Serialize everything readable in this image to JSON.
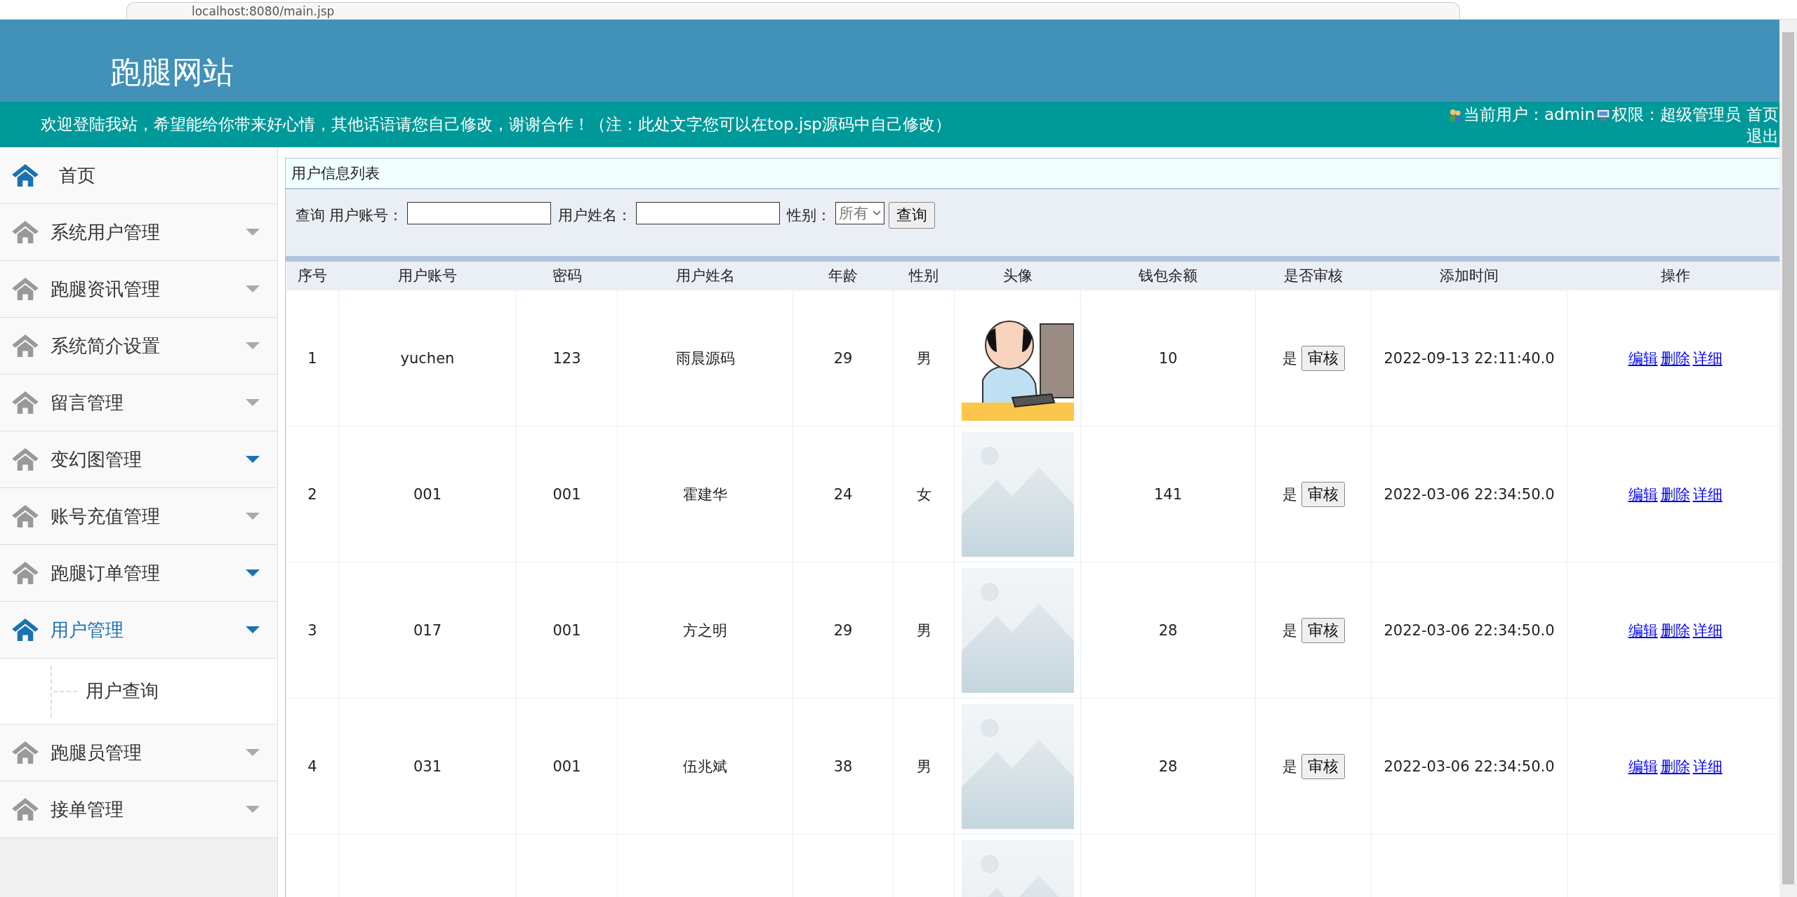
{
  "browser": {
    "url": "localhost:8080/main.jsp"
  },
  "header": {
    "site_title": "跑腿网站",
    "welcome": "欢迎登陆我站，希望能给你带来好心情，其他话语请您自己修改，谢谢合作！（注：此处文字您可以在top.jsp源码中自己修改）",
    "user_label": "当前用户：admin",
    "role_label": "权限：超级管理员",
    "links": [
      "首页",
      "退出"
    ]
  },
  "sidebar": {
    "items": [
      {
        "label": "首页",
        "kind": "home",
        "expanded": false
      },
      {
        "label": "系统用户管理",
        "kind": "menu",
        "expanded": false,
        "caret_highlighted": false
      },
      {
        "label": "跑腿资讯管理",
        "kind": "menu",
        "expanded": false,
        "caret_highlighted": false
      },
      {
        "label": "系统简介设置",
        "kind": "menu",
        "expanded": false,
        "caret_highlighted": false
      },
      {
        "label": "留言管理",
        "kind": "menu",
        "expanded": false,
        "caret_highlighted": false
      },
      {
        "label": "变幻图管理",
        "kind": "menu",
        "expanded": false,
        "caret_highlighted": true
      },
      {
        "label": "账号充值管理",
        "kind": "menu",
        "expanded": false,
        "caret_highlighted": false
      },
      {
        "label": "跑腿订单管理",
        "kind": "menu",
        "expanded": false,
        "caret_highlighted": true
      },
      {
        "label": "用户管理",
        "kind": "menu",
        "expanded": true,
        "caret_highlighted": true,
        "children": [
          {
            "label": "用户查询"
          }
        ]
      },
      {
        "label": "跑腿员管理",
        "kind": "menu",
        "expanded": false,
        "caret_highlighted": false
      },
      {
        "label": "接单管理",
        "kind": "menu",
        "expanded": false,
        "caret_highlighted": false
      }
    ]
  },
  "panel": {
    "title": "用户信息列表",
    "search": {
      "prefix": "查询",
      "fields": [
        {
          "label": "用户账号：",
          "kind": "text"
        },
        {
          "label": "用户姓名：",
          "kind": "text"
        },
        {
          "label": "性别：",
          "kind": "select",
          "value": "所有"
        }
      ],
      "button": "查询"
    },
    "table": {
      "columns": [
        "序号",
        "用户账号",
        "密码",
        "用户姓名",
        "年龄",
        "性别",
        "头像",
        "钱包余额",
        "是否审核",
        "添加时间",
        "操作"
      ],
      "rows": [
        {
          "cells": [
            "1",
            "yuchen",
            "123",
            "雨晨源码",
            "29",
            "男"
          ],
          "avatar": {
            "kind": "picture",
            "placeholder": false
          },
          "balance": "10",
          "reviewed": "是",
          "review_button": "审核",
          "added": "2022-09-13 22:11:40.0",
          "actions": [
            "编辑",
            "删除",
            "详细"
          ]
        },
        {
          "cells": [
            "2",
            "001",
            "001",
            "霍建华",
            "24",
            "女"
          ],
          "avatar": {
            "kind": "picture",
            "placeholder": true
          },
          "balance": "141",
          "reviewed": "是",
          "review_button": "审核",
          "added": "2022-03-06 22:34:50.0",
          "actions": [
            "编辑",
            "删除",
            "详细"
          ]
        },
        {
          "cells": [
            "3",
            "017",
            "001",
            "方之明",
            "29",
            "男"
          ],
          "avatar": {
            "kind": "picture",
            "placeholder": true
          },
          "balance": "28",
          "reviewed": "是",
          "review_button": "审核",
          "added": "2022-03-06 22:34:50.0",
          "actions": [
            "编辑",
            "删除",
            "详细"
          ]
        },
        {
          "cells": [
            "4",
            "031",
            "001",
            "伍兆斌",
            "38",
            "男"
          ],
          "avatar": {
            "kind": "picture",
            "placeholder": true
          },
          "balance": "28",
          "reviewed": "是",
          "review_button": "审核",
          "added": "2022-03-06 22:34:50.0",
          "actions": [
            "编辑",
            "删除",
            "详细"
          ]
        },
        {
          "avatar": {
            "kind": "picture",
            "placeholder": true
          }
        }
      ]
    }
  }
}
